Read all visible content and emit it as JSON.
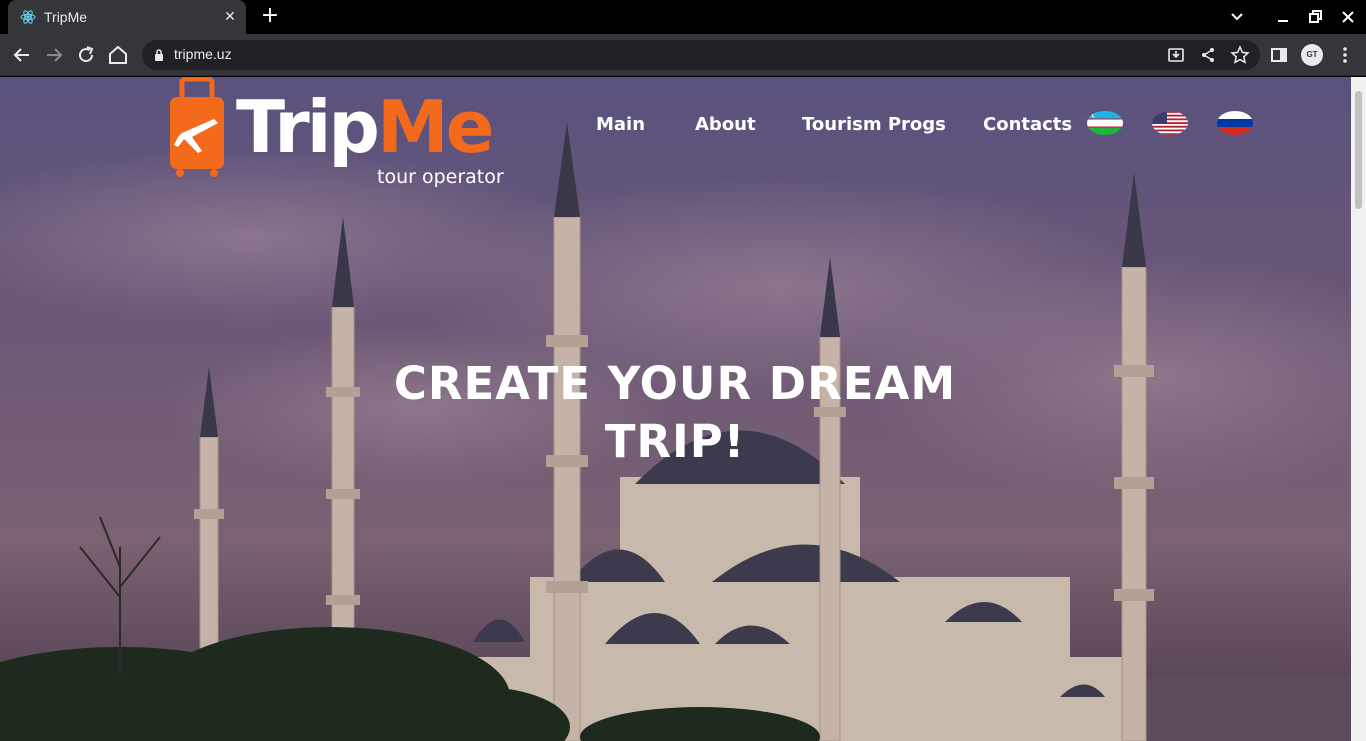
{
  "browser": {
    "tab_title": "TripMe",
    "url": "tripme.uz",
    "profile_initials": "GT",
    "icons": [
      "react-favicon-icon",
      "close-icon",
      "plus-icon",
      "chevron-down-icon",
      "minimize-icon",
      "restore-icon",
      "close-window-icon",
      "back-icon",
      "forward-icon",
      "reload-icon",
      "home-icon",
      "lock-icon",
      "install-icon",
      "share-icon",
      "star-icon",
      "side-panel-icon",
      "kebab-menu-icon"
    ]
  },
  "site": {
    "logo": {
      "word_white": "Trip",
      "word_orange": "Me",
      "subtitle": "tour operator"
    },
    "nav": [
      "Main",
      "About",
      "Tourism Progs",
      "Contacts"
    ],
    "languages": [
      "uz-flag",
      "us-flag",
      "ru-flag"
    ],
    "hero": {
      "line1": "CREATE YOUR DREAM",
      "line2": "TRIP!"
    },
    "colors": {
      "brand_orange": "#f36a1d",
      "overlay": "#3d2f4f"
    }
  }
}
